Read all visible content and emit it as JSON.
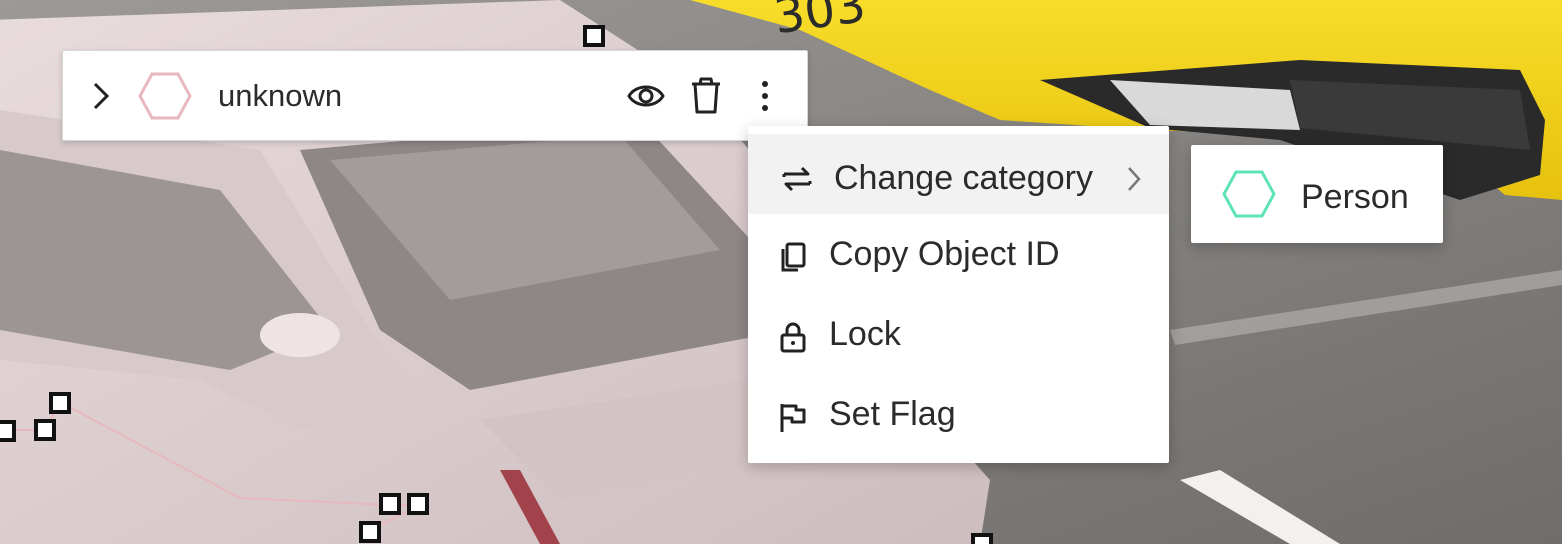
{
  "object": {
    "name": "unknown",
    "hex_color": "#e7b8bd"
  },
  "context_menu": {
    "items": [
      {
        "label": "Change category",
        "icon": "swap-arrows-icon",
        "has_submenu": true,
        "active": true
      },
      {
        "label": "Copy Object ID",
        "icon": "copy-icon"
      },
      {
        "label": "Lock",
        "icon": "lock-icon"
      },
      {
        "label": "Set Flag",
        "icon": "flag-icon"
      }
    ]
  },
  "category_submenu": {
    "items": [
      {
        "label": "Person",
        "hex_color": "#5ee3b5"
      }
    ]
  },
  "colors": {
    "taxi_yellow": "#f4d51a",
    "selection_tint": "#d9c9cb"
  }
}
